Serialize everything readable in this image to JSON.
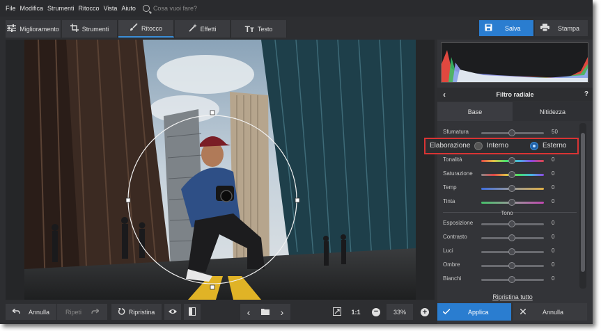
{
  "menu": [
    "File",
    "Modifica",
    "Strumenti",
    "Ritocco",
    "Vista",
    "Aiuto"
  ],
  "search": {
    "placeholder": "Cosa vuoi fare?"
  },
  "tabs": [
    {
      "label": "Miglioramento",
      "icon": "sliders-icon"
    },
    {
      "label": "Strumenti",
      "icon": "crop-icon"
    },
    {
      "label": "Ritocco",
      "icon": "brush-icon"
    },
    {
      "label": "Effetti",
      "icon": "magic-wand-icon"
    },
    {
      "label": "Testo",
      "icon": "text-icon"
    }
  ],
  "toolbar": {
    "save_label": "Salva",
    "print_label": "Stampa"
  },
  "panel": {
    "title": "Filtro radiale",
    "help": "?",
    "tabs": [
      "Base",
      "Nitidezza"
    ],
    "sfumatura": {
      "label": "Sfumatura",
      "value": "50"
    },
    "elaborazione": {
      "label": "Elaborazione",
      "option_inner": "Interno",
      "option_outer": "Esterno",
      "selected": "Esterno"
    },
    "color_sliders": [
      {
        "label": "Tonalità",
        "value": "0"
      },
      {
        "label": "Saturazione",
        "value": "0"
      },
      {
        "label": "Temp",
        "value": "0"
      },
      {
        "label": "Tinta",
        "value": "0"
      }
    ],
    "tone_heading": "Tono",
    "tone_sliders": [
      {
        "label": "Esposizione",
        "value": "0"
      },
      {
        "label": "Contrasto",
        "value": "0"
      },
      {
        "label": "Luci",
        "value": "0"
      },
      {
        "label": "Ombre",
        "value": "0"
      },
      {
        "label": "Bianchi",
        "value": "0"
      }
    ],
    "reset_all": "Ripristina tutto",
    "apply_label": "Applica",
    "cancel_label": "Annulla"
  },
  "bottom": {
    "undo_label": "Annulla",
    "redo_label": "Ripeti",
    "reset_label": "Ripristina",
    "ratio_label": "1:1",
    "zoom": "33%"
  },
  "colors": {
    "accent": "#2a7dd0",
    "highlight": "#d93434",
    "bg": "#2d2e31"
  }
}
